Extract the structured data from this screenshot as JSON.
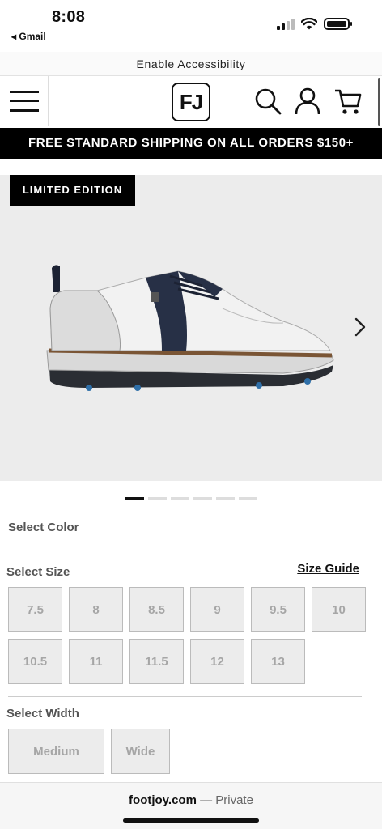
{
  "status_bar": {
    "time": "8:08",
    "back_app": "◂ Gmail"
  },
  "accessibility": {
    "label": "Enable Accessibility"
  },
  "header": {
    "logo_text": "FJ",
    "icons": [
      "menu-icon",
      "search-icon",
      "account-icon",
      "cart-icon"
    ]
  },
  "banner": {
    "text": "FREE STANDARD SHIPPING ON ALL ORDERS $150+"
  },
  "product": {
    "badge": "LIMITED EDITION",
    "carousel_total": 6,
    "carousel_active": 1
  },
  "color": {
    "label": "Select Color"
  },
  "size": {
    "label": "Select Size",
    "guide_label": "Size Guide",
    "options": [
      "7.5",
      "8",
      "8.5",
      "9",
      "9.5",
      "10",
      "10.5",
      "11",
      "11.5",
      "12",
      "13"
    ]
  },
  "width": {
    "label": "Select Width",
    "options": [
      "Medium",
      "Wide"
    ]
  },
  "browser": {
    "domain": "footjoy.com",
    "privacy": " — Private"
  },
  "colors": {
    "banner_bg": "#000000",
    "option_bg": "#ececec",
    "option_text": "#a6a6a6",
    "image_bg": "#ececec"
  }
}
